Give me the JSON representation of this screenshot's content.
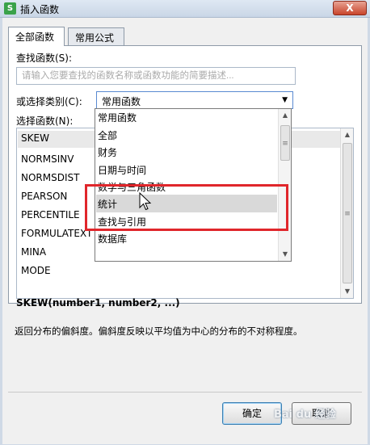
{
  "window": {
    "title": "插入函数",
    "app_icon": "S",
    "close_label": "X"
  },
  "tabs": [
    {
      "label": "全部函数"
    },
    {
      "label": "常用公式"
    }
  ],
  "search": {
    "label": "查找函数(S):",
    "placeholder": "请输入您要查找的函数名称或函数功能的简要描述..."
  },
  "category": {
    "label": "或选择类别(C):",
    "value": "常用函数"
  },
  "functions": {
    "label": "选择函数(N):",
    "items": [
      "SKEW",
      "NORMSINV",
      "NORMSDIST",
      "PEARSON",
      "PERCENTILE",
      "FORMULATEXT",
      "MINA",
      "MODE"
    ],
    "selected": "SKEW"
  },
  "dropdown": {
    "options": [
      "常用函数",
      "全部",
      "财务",
      "日期与时间",
      "数学与三角函数",
      "统计",
      "查找与引用",
      "数据库"
    ],
    "highlighted": "统计"
  },
  "signature": "SKEW(number1, number2, ...)",
  "description": "返回分布的偏斜度。偏斜度反映以平均值为中心的分布的不对称程度。",
  "buttons": {
    "ok": "确定",
    "cancel": "取消"
  },
  "watermark": "Bai du 经验",
  "colors": {
    "highlight_box": "#e0262b",
    "list_selection": "#e9e9e9",
    "dropdown_hover": "#d9d9d9"
  }
}
